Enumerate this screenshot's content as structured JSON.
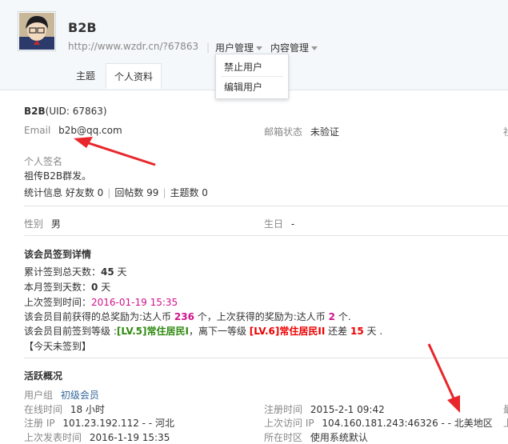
{
  "header": {
    "username": "B2B",
    "home_url": "http://www.wzdr.cn/?67863",
    "nav": [
      {
        "label": "用户管理"
      },
      {
        "label": "内容管理"
      }
    ],
    "dropdown": [
      "禁止用户",
      "编辑用户"
    ],
    "tabs": [
      {
        "label": "主题",
        "active": false
      },
      {
        "label": "个人资料",
        "active": true
      }
    ]
  },
  "profile": {
    "name": "B2B",
    "uid": "(UID: 67863)",
    "email_label": "Email",
    "email": "b2b@qq.com",
    "email_status_label": "邮箱状态",
    "email_status": "未验证",
    "signature_label": "个人签名",
    "signature": "祖传B2B群发。",
    "stats_label": "统计信息",
    "friends": "好友数 0",
    "replies": "回帖数 99",
    "threads": "主题数 0",
    "gender_label": "性别",
    "gender": "男",
    "birthday_label": "生日",
    "birthday": "-"
  },
  "checkin": {
    "title": "该会员签到详情",
    "total_days_label": "累计签到总天数：",
    "total_days": "45",
    "total_days_unit": "天",
    "month_days_label": "本月签到天数：",
    "month_days": "0",
    "month_days_unit": "天",
    "last_time_label": "上次签到时间：",
    "last_time": "2016-01-19 15:35",
    "reward_prefix": "该会员目前获得的总奖励为:达人币",
    "reward_total": "236",
    "reward_mid": "个，上次获得的奖励为:达人币",
    "reward_last": "2",
    "reward_suffix": "个.",
    "level_prefix": "该会员目前签到等级 :",
    "level_current": "[LV.5]常住居民I",
    "level_mid": "，离下一等级",
    "level_next": "[LV.6]常住居民II",
    "level_remain_prefix": "还差",
    "level_remain": "15",
    "level_remain_suffix": "天 .",
    "today": "【今天未签到】"
  },
  "activity": {
    "title": "活跃概况",
    "group_label": "用户组",
    "group": "初级会员",
    "online_label": "在线时间",
    "online": "18 小时",
    "reg_time_label": "注册时间",
    "reg_time": "2015-2-1 09:42",
    "reg_ip_label": "注册 IP",
    "reg_ip": "101.23.192.112 - - 河北",
    "last_ip_label": "上次访问 IP",
    "last_ip": "104.160.181.243:46326 - - 北美地区",
    "last_post_label": "上次发表时间",
    "last_post": "2016-1-19 15:35",
    "location_label": "所在时区",
    "location": "使用系统默认"
  },
  "colors": {
    "annotation_arrow": "#e8262b",
    "link": "#336699",
    "pink": "#d0138b",
    "green": "#2f8a10",
    "red": "#ee0000"
  }
}
